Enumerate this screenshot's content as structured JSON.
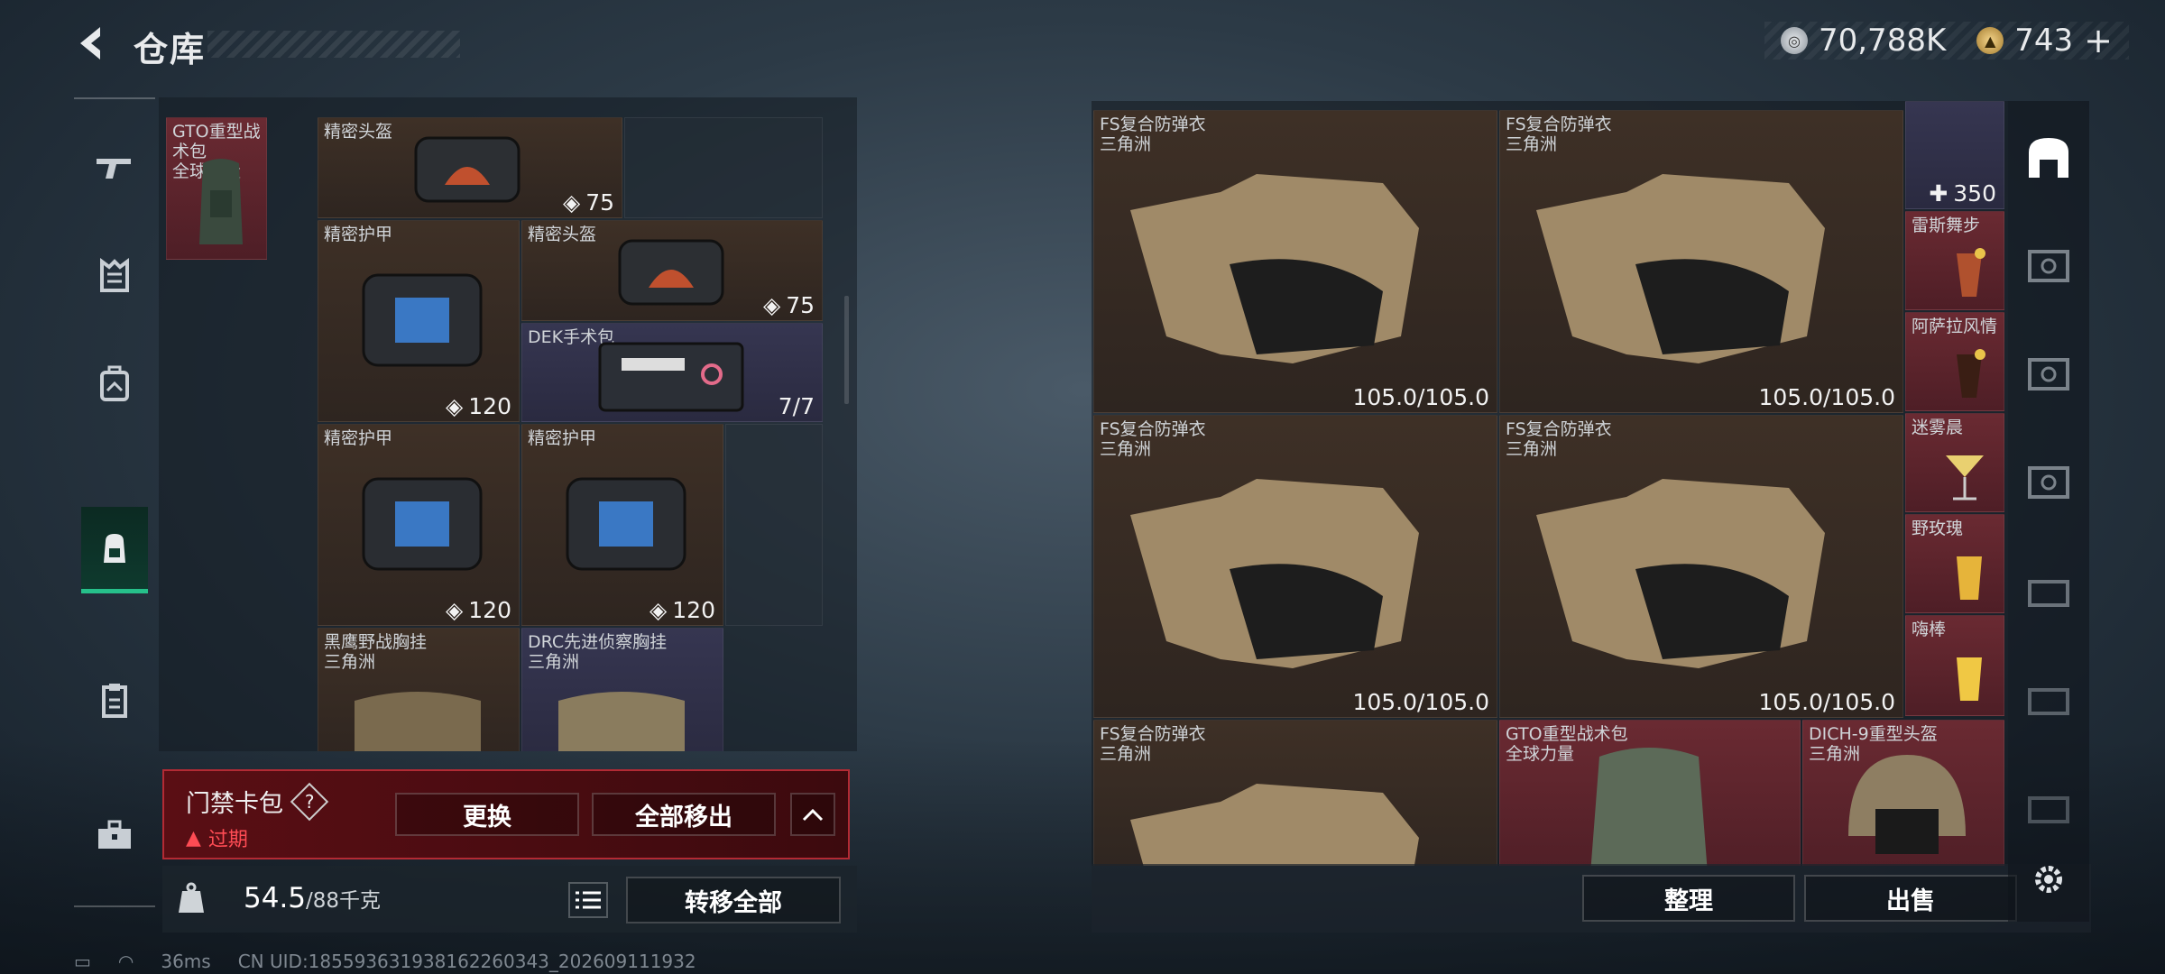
{
  "header": {
    "title": "仓库",
    "silver": "70,788K",
    "gold": "743",
    "gold_plus": "+"
  },
  "nav": {
    "items": [
      "weapon-icon",
      "armor-icon",
      "vest-icon",
      "backpack-icon",
      "clipboard-icon",
      "toolbox-icon"
    ],
    "active": 3
  },
  "left_items": [
    {
      "name": "GTO重型战术包",
      "sub": "全球力量",
      "value": "",
      "color": "red"
    },
    {
      "name": "精密头盔",
      "value": "75",
      "color": "brown"
    },
    {
      "name": "精密护甲",
      "value": "120",
      "color": "brown"
    },
    {
      "name": "精密头盔",
      "value": "75",
      "color": "brown"
    },
    {
      "name": "DEK手术包",
      "value": "7/7",
      "color": "purple"
    },
    {
      "name": "精密护甲",
      "value": "120",
      "color": "brown"
    },
    {
      "name": "精密护甲",
      "value": "120",
      "color": "brown"
    },
    {
      "name": "黑鹰野战胸挂",
      "sub": "三角洲",
      "value": "",
      "color": "brown"
    },
    {
      "name": "DRC先进侦察胸挂",
      "sub": "三角洲",
      "value": "",
      "color": "purple"
    }
  ],
  "bag": {
    "name": "门禁卡包",
    "help": "?",
    "status": "过期",
    "replace": "更换",
    "remove_all": "全部移出"
  },
  "weight": {
    "current": "54.5",
    "max": "/88千克",
    "transfer_all": "转移全部"
  },
  "right_items": [
    {
      "name": "FS复合防弹衣",
      "sub": "三角洲",
      "value": "105.0/105.0"
    },
    {
      "name": "FS复合防弹衣",
      "sub": "三角洲",
      "value": "105.0/105.0"
    },
    {
      "name": "FS复合防弹衣",
      "sub": "三角洲",
      "value": "105.0/105.0"
    },
    {
      "name": "FS复合防弹衣",
      "sub": "三角洲",
      "value": "105.0/105.0"
    },
    {
      "name": "FS复合防弹衣",
      "sub": "三角洲",
      "value": ""
    },
    {
      "name": "GTO重型战术包",
      "sub": "全球力量",
      "value": ""
    },
    {
      "name": "DICH-9重型头盔",
      "sub": "三角洲",
      "value": ""
    }
  ],
  "right_small": [
    {
      "name": "",
      "value": "350"
    },
    {
      "name": "雷斯舞步"
    },
    {
      "name": "阿萨拉风情"
    },
    {
      "name": "迷雾晨"
    },
    {
      "name": "野玫瑰"
    },
    {
      "name": "嗨棒"
    }
  ],
  "actions": {
    "sort": "整理",
    "sell": "出售"
  },
  "status": {
    "ping": "36ms",
    "uid": "CN UID:1855936319381622603​43_202609111932"
  }
}
